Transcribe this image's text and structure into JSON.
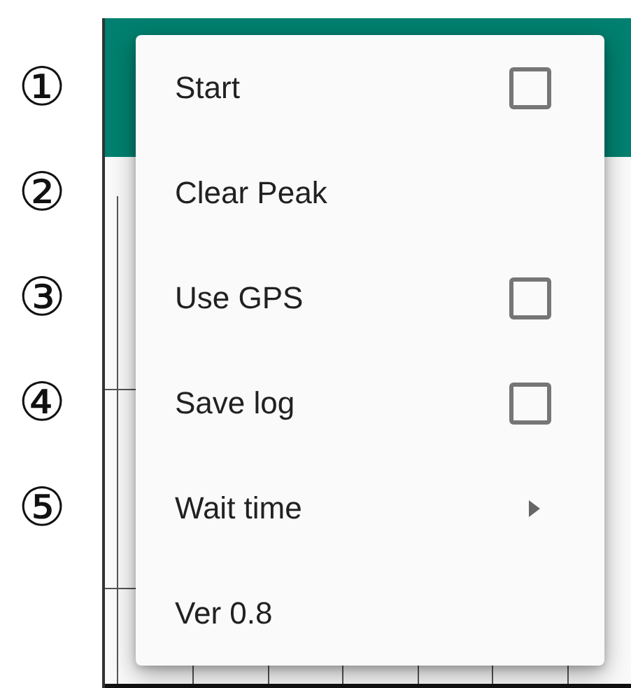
{
  "callouts": [
    "①",
    "②",
    "③",
    "④",
    "⑤"
  ],
  "menu": [
    {
      "kind": "checkbox",
      "label": "Start",
      "checked": false
    },
    {
      "kind": "action",
      "label": "Clear Peak"
    },
    {
      "kind": "checkbox",
      "label": "Use GPS",
      "checked": false
    },
    {
      "kind": "checkbox",
      "label": "Save log",
      "checked": false
    },
    {
      "kind": "submenu",
      "label": "Wait time"
    },
    {
      "kind": "action",
      "label": "Ver 0.8"
    }
  ]
}
